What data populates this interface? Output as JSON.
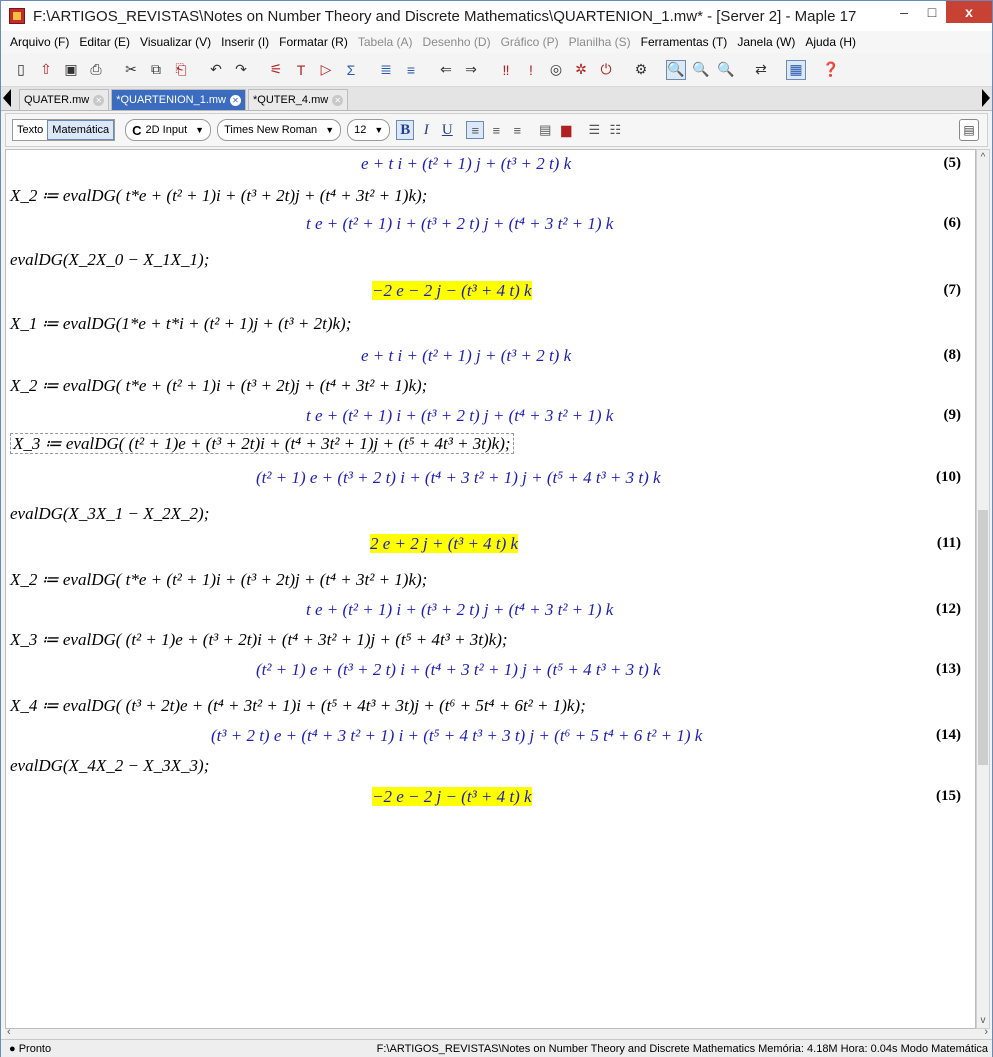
{
  "window": {
    "title": "F:\\ARTIGOS_REVISTAS\\Notes on Number Theory and Discrete Mathematics\\QUARTENION_1.mw* - [Server 2] - Maple 17",
    "minimize": "–",
    "maximize": "□",
    "close": "x"
  },
  "menu": [
    {
      "label": "Arquivo (F)"
    },
    {
      "label": "Editar (E)"
    },
    {
      "label": "Visualizar (V)"
    },
    {
      "label": "Inserir (I)"
    },
    {
      "label": "Formatar (R)"
    },
    {
      "label": "Tabela (A)"
    },
    {
      "label": "Desenho (D)"
    },
    {
      "label": "Gráfico (P)"
    },
    {
      "label": "Planilha (S)"
    },
    {
      "label": "Ferramentas (T)"
    },
    {
      "label": "Janela (W)"
    },
    {
      "label": "Ajuda (H)"
    }
  ],
  "toolbar": {
    "icons": [
      "new-document-icon",
      "open-icon",
      "save-icon",
      "print-icon",
      "cut-icon",
      "copy-icon",
      "paste-icon",
      "undo-icon",
      "redo-icon",
      "math-input-icon",
      "text-icon",
      "prompt-icon",
      "sigma-icon",
      "section-icon",
      "unsection-icon",
      "back-icon",
      "forward-icon",
      "execute-all-icon",
      "execute-icon",
      "stop-icon",
      "debug-icon",
      "restart-icon",
      "settings-icon",
      "zoom-100-icon",
      "zoom-150-icon",
      "zoom-200-icon",
      "toggle-icon",
      "palette-icon",
      "help-icon"
    ],
    "glyphs": [
      "▯",
      "⇧",
      "▣",
      "⎙",
      "✂",
      "⧉",
      "⎗",
      "↶",
      "↷",
      "⚟",
      "T",
      "▷",
      "Σ",
      "≣",
      "≡",
      "⇐",
      "⇒",
      "‼",
      "!",
      "◎",
      "✲",
      "⏻",
      "⚙",
      "🔍",
      "🔍",
      "🔍",
      "⇄",
      "▦",
      "❓"
    ]
  },
  "tabs": [
    {
      "label": "QUATER.mw"
    },
    {
      "label": "*QUARTENION_1.mw"
    },
    {
      "label": "*QUTER_4.mw"
    }
  ],
  "context": {
    "texto": "Texto",
    "matematica": "Matemática",
    "input_mode": "2D Input",
    "input_mode_prefix": "C",
    "font": "Times New Roman",
    "size": "12",
    "bold": "B",
    "italic": "I",
    "underline": "U"
  },
  "document": {
    "lines": [
      {
        "kind": "output",
        "text": "e + t i + (t² + 1) j + (t³ + 2 t) k",
        "eq": "(5)"
      },
      {
        "kind": "input",
        "text": "X_2 ≔ evalDG( t*e + (t² + 1)i + (t³ + 2t)j + (t⁴ + 3t² + 1)k);"
      },
      {
        "kind": "output",
        "text": "t e + (t² + 1) i + (t³ + 2 t) j + (t⁴ + 3 t² + 1) k",
        "eq": "(6)"
      },
      {
        "kind": "input",
        "text": "evalDG(X_2X_0 − X_1X_1);"
      },
      {
        "kind": "output",
        "text": "−2 e − 2 j − (t³ + 4 t) k",
        "eq": "(7)",
        "hl": true
      },
      {
        "kind": "input",
        "text": "X_1 ≔ evalDG(1*e + t*i + (t² + 1)j + (t³ + 2t)k);"
      },
      {
        "kind": "output",
        "text": "e + t i + (t² + 1) j + (t³ + 2 t) k",
        "eq": "(8)"
      },
      {
        "kind": "input",
        "text": "X_2 ≔ evalDG( t*e + (t² + 1)i + (t³ + 2t)j + (t⁴ + 3t² + 1)k);"
      },
      {
        "kind": "output",
        "text": "t e + (t² + 1) i + (t³ + 2 t) j + (t⁴ + 3 t² + 1) k",
        "eq": "(9)"
      },
      {
        "kind": "input",
        "text": "X_3 ≔ evalDG( (t² + 1)e + (t³ + 2t)i + (t⁴ + 3t² + 1)j + (t⁵ + 4t³ + 3t)k);",
        "boxed": true
      },
      {
        "kind": "output",
        "text": "(t² + 1) e + (t³ + 2 t) i + (t⁴ + 3 t² + 1) j + (t⁵ + 4 t³ + 3 t) k",
        "eq": "(10)"
      },
      {
        "kind": "input",
        "text": "evalDG(X_3X_1 − X_2X_2);"
      },
      {
        "kind": "output",
        "text": "2 e + 2 j + (t³ + 4 t) k",
        "eq": "(11)",
        "hl": true
      },
      {
        "kind": "input",
        "text": "X_2 ≔ evalDG( t*e + (t² + 1)i + (t³ + 2t)j + (t⁴ + 3t² + 1)k);"
      },
      {
        "kind": "output",
        "text": "t e + (t² + 1) i + (t³ + 2 t) j + (t⁴ + 3 t² + 1) k",
        "eq": "(12)"
      },
      {
        "kind": "input",
        "text": "X_3 ≔ evalDG( (t² + 1)e + (t³ + 2t)i + (t⁴ + 3t² + 1)j + (t⁵ + 4t³ + 3t)k);"
      },
      {
        "kind": "output",
        "text": "(t² + 1) e + (t³ + 2 t) i + (t⁴ + 3 t² + 1) j + (t⁵ + 4 t³ + 3 t) k",
        "eq": "(13)"
      },
      {
        "kind": "input",
        "text": "X_4 ≔ evalDG( (t³ + 2t)e + (t⁴ + 3t² + 1)i + (t⁵ + 4t³ + 3t)j + (t⁶ + 5t⁴ + 6t² + 1)k);"
      },
      {
        "kind": "output",
        "text": "(t³ + 2 t) e + (t⁴ + 3 t² + 1) i + (t⁵ + 4 t³ + 3 t) j + (t⁶ + 5 t⁴ + 6 t² + 1) k",
        "eq": "(14)"
      },
      {
        "kind": "input",
        "text": "evalDG(X_4X_2 − X_3X_3);"
      },
      {
        "kind": "output",
        "text": "−2 e − 2 j − (t³ + 4 t) k",
        "eq": "(15)",
        "hl": true
      }
    ]
  },
  "status": {
    "left": "● Pronto",
    "right": "F:\\ARTIGOS_REVISTAS\\Notes on Number Theory and Discrete Mathematics  Memória: 4.18M  Hora: 0.04s  Modo Matemática"
  }
}
